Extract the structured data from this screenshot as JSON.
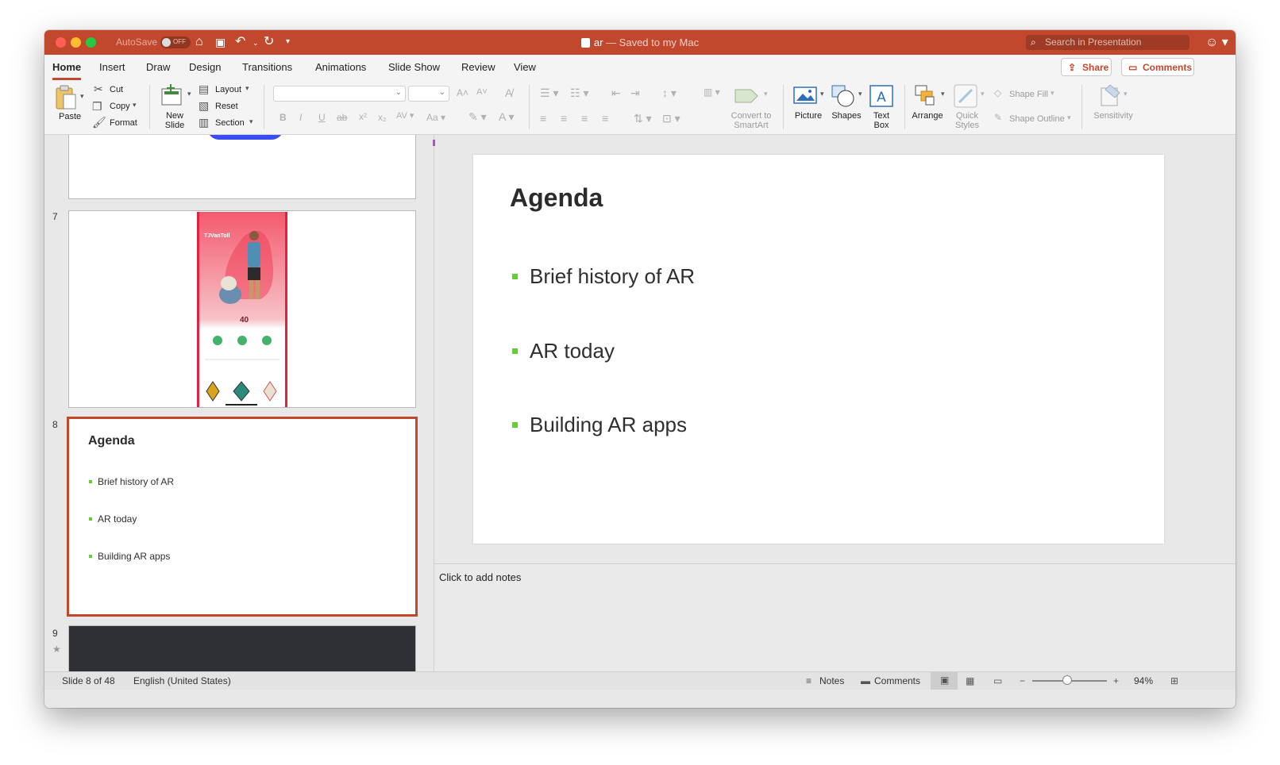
{
  "window": {
    "autosave_label": "AutoSave",
    "autosave_state": "OFF",
    "doc_name": "ar",
    "doc_status": " — Saved to my Mac",
    "search_placeholder": "Search in Presentation"
  },
  "tabs": [
    "Home",
    "Insert",
    "Draw",
    "Design",
    "Transitions",
    "Animations",
    "Slide Show",
    "Review",
    "View"
  ],
  "active_tab": "Home",
  "share_label": "Share",
  "comments_label": "Comments",
  "ribbon": {
    "paste": "Paste",
    "cut": "Cut",
    "copy": "Copy",
    "format": "Format",
    "new_slide_1": "New",
    "new_slide_2": "Slide",
    "layout": "Layout",
    "reset": "Reset",
    "section": "Section",
    "convert_1": "Convert to",
    "convert_2": "SmartArt",
    "picture": "Picture",
    "shapes": "Shapes",
    "text_box_1": "Text",
    "text_box_2": "Box",
    "arrange": "Arrange",
    "quick_styles_1": "Quick",
    "quick_styles_2": "Styles",
    "shape_fill": "Shape Fill",
    "shape_outline": "Shape Outline",
    "sensitivity": "Sensitivity"
  },
  "thumbnails": {
    "slide7_number": "7",
    "slide8_number": "8",
    "slide9_number": "9",
    "slide7_username": "TJVanToll",
    "slide7_level": "40",
    "slide8_title": "Agenda",
    "slide8_bullets": [
      "Brief history of AR",
      "AR today",
      "Building AR apps"
    ]
  },
  "slide": {
    "title": "Agenda",
    "bullets": [
      "Brief history of AR",
      "AR today",
      "Building AR apps"
    ]
  },
  "notes_placeholder": "Click to add notes",
  "status": {
    "slide_info": "Slide 8 of 48",
    "language": "English (United States)",
    "notes": "Notes",
    "comments": "Comments",
    "zoom": "94%"
  },
  "colors": {
    "accent": "#c2482d",
    "bullet": "#5fd32b"
  }
}
